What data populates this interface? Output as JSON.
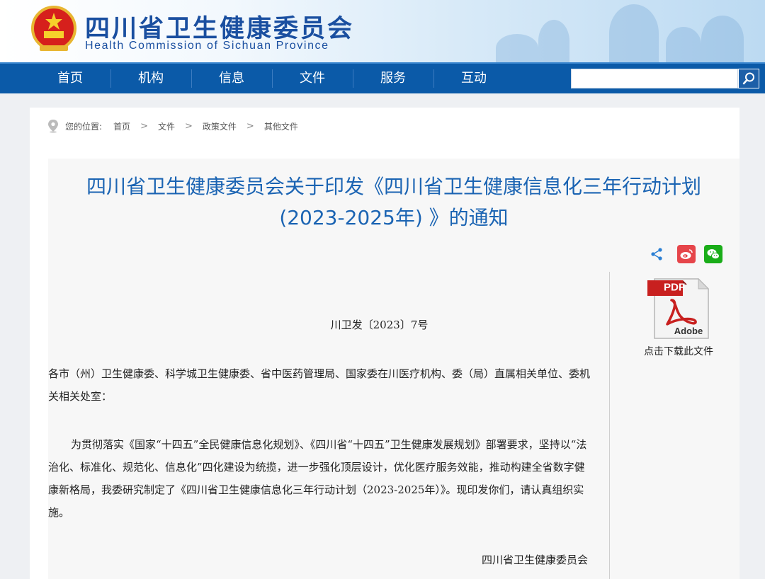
{
  "header": {
    "title_cn": "四川省卫生健康委员会",
    "title_en": "Health Commission of Sichuan Province"
  },
  "nav": {
    "items": [
      "首页",
      "机构",
      "信息",
      "文件",
      "服务",
      "互动"
    ],
    "search_placeholder": ""
  },
  "breadcrumb": {
    "prefix": "您的位置:",
    "items": [
      "首页",
      "文件",
      "政策文件",
      "其他文件"
    ],
    "separator": ">"
  },
  "article": {
    "title_line1": "四川省卫生健康委员会关于印发《四川省卫生健康信息化三年行动计划",
    "title_line2": "(2023-2025年) 》的通知",
    "doc_number": "川卫发〔2023〕7号",
    "recipients": "各市（州）卫生健康委、科学城卫生健康委、省中医药管理局、国家委在川医疗机构、委（局）直属相关单位、委机关相关处室：",
    "body": "为贯彻落实《国家“十四五”全民健康信息化规划》、《四川省“十四五”卫生健康发展规划》部署要求，坚持以“法治化、标准化、规范化、信息化”四化建设为统揽，进一步强化顶层设计，优化医疗服务效能，推动构建全省数字健康新格局，我委研究制定了《四川省卫生健康信息化三年行动计划（2023-2025年）》。现印发你们，请认真组织实施。",
    "signature": "四川省卫生健康委员会"
  },
  "download": {
    "pdf_label": "PDF",
    "adobe_label": "Adobe",
    "caption": "点击下载此文件"
  },
  "colors": {
    "nav_blue": "#0b5aa8",
    "title_blue": "#1b64b3",
    "weibo_red": "#e6454a",
    "wechat_green": "#1aad19"
  }
}
